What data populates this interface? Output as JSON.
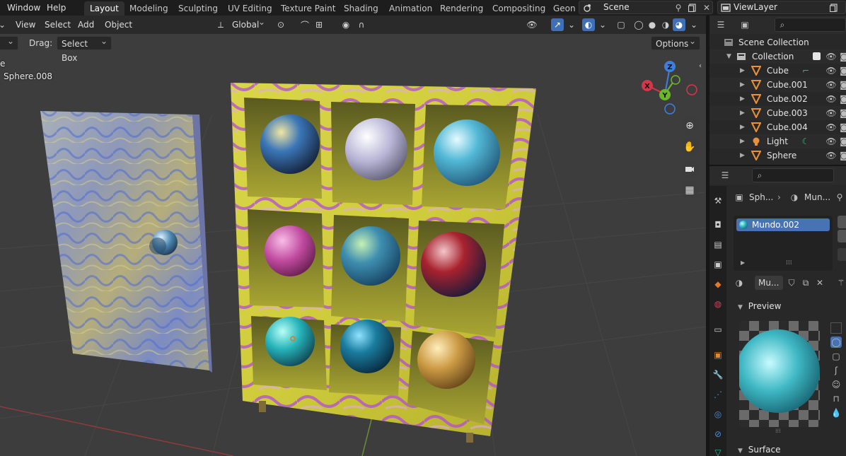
{
  "menu": {
    "window": "Window",
    "help": "Help"
  },
  "workspaces": [
    "Layout",
    "Modeling",
    "Sculpting",
    "UV Editing",
    "Texture Paint",
    "Shading",
    "Animation",
    "Rendering",
    "Compositing",
    "Geon"
  ],
  "scene": {
    "name": "Scene"
  },
  "view_layer": {
    "name": "ViewLayer"
  },
  "viewport_header": {
    "menus": [
      "View",
      "Select",
      "Add",
      "Object"
    ],
    "orientation": "Global"
  },
  "tool_options": {
    "drag_label": "Drag:",
    "drag_value": "Select Box",
    "options_label": "Options"
  },
  "overlay_text": {
    "line1": "e",
    "line2": "Sphere.008"
  },
  "gizmo": {
    "z": "Z",
    "x": "X",
    "y": "Y"
  },
  "outliner": {
    "scene_collection": "Scene Collection",
    "collection": "Collection",
    "items": [
      {
        "name": "Cube",
        "type": "mesh"
      },
      {
        "name": "Cube.001",
        "type": "mesh"
      },
      {
        "name": "Cube.002",
        "type": "mesh"
      },
      {
        "name": "Cube.003",
        "type": "mesh"
      },
      {
        "name": "Cube.004",
        "type": "mesh"
      },
      {
        "name": "Light",
        "type": "light"
      },
      {
        "name": "Sphere",
        "type": "mesh"
      }
    ]
  },
  "properties": {
    "breadcrumb_object": "Sph...",
    "breadcrumb_material": "Mun...",
    "material_slot": "Mundo.002",
    "material_name": "Mu...",
    "preview_label": "Preview",
    "surface_label": "Surface"
  },
  "colors": {
    "accent": "#4772b3",
    "active_tab": "#303030",
    "viewport_bg": "#3d3d3d"
  }
}
